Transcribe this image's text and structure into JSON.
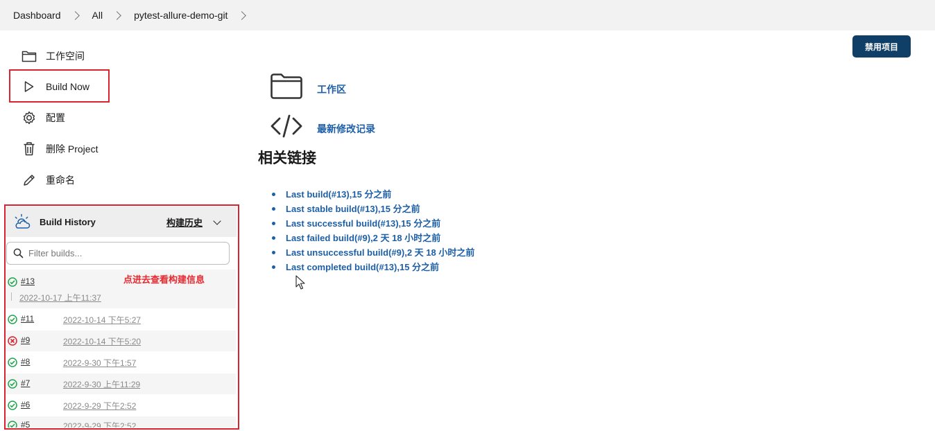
{
  "breadcrumb": [
    "Dashboard",
    "All",
    "pytest-allure-demo-git"
  ],
  "sidebar": {
    "items": [
      {
        "label": "工作空间",
        "icon": "folder-icon"
      },
      {
        "label": "Build Now",
        "icon": "play-icon"
      },
      {
        "label": "配置",
        "icon": "gear-icon"
      },
      {
        "label": "删除 Project",
        "icon": "trash-icon"
      },
      {
        "label": "重命名",
        "icon": "pencil-icon"
      }
    ]
  },
  "header": {
    "disable_label": "禁用项目"
  },
  "main": {
    "workspace_link": "工作区",
    "changes_link": "最新修改记录",
    "related_title": "相关链接",
    "permalinks": [
      "Last build(#13),15 分之前",
      "Last stable build(#13),15 分之前",
      "Last successful build(#13),15 分之前",
      "Last failed build(#9),2 天 18 小时之前",
      "Last unsuccessful build(#9),2 天 18 小时之前",
      "Last completed build(#13),15 分之前"
    ]
  },
  "build_history": {
    "title": "Build History",
    "trend_label": "构建历史",
    "filter_placeholder": "Filter builds...",
    "annotation": "点进去查看构建信息",
    "builds": [
      {
        "number": "#13",
        "date": "2022-10-17 上午11:37",
        "status": "success"
      },
      {
        "number": "#11",
        "date": "2022-10-14 下午5:27",
        "status": "success"
      },
      {
        "number": "#9",
        "date": "2022-10-14 下午5:20",
        "status": "failed"
      },
      {
        "number": "#8",
        "date": "2022-9-30 下午1:57",
        "status": "success"
      },
      {
        "number": "#7",
        "date": "2022-9-30 上午11:29",
        "status": "success"
      },
      {
        "number": "#6",
        "date": "2022-9-29 下午2:52",
        "status": "success"
      },
      {
        "number": "#5",
        "date": "2022-9-29 下午2:52",
        "status": "success"
      }
    ]
  },
  "colors": {
    "link": "#1d5fa7",
    "success": "#1ea64b",
    "failed": "#d9232e",
    "button": "#0f3f66",
    "highlight": "#d9232e"
  }
}
